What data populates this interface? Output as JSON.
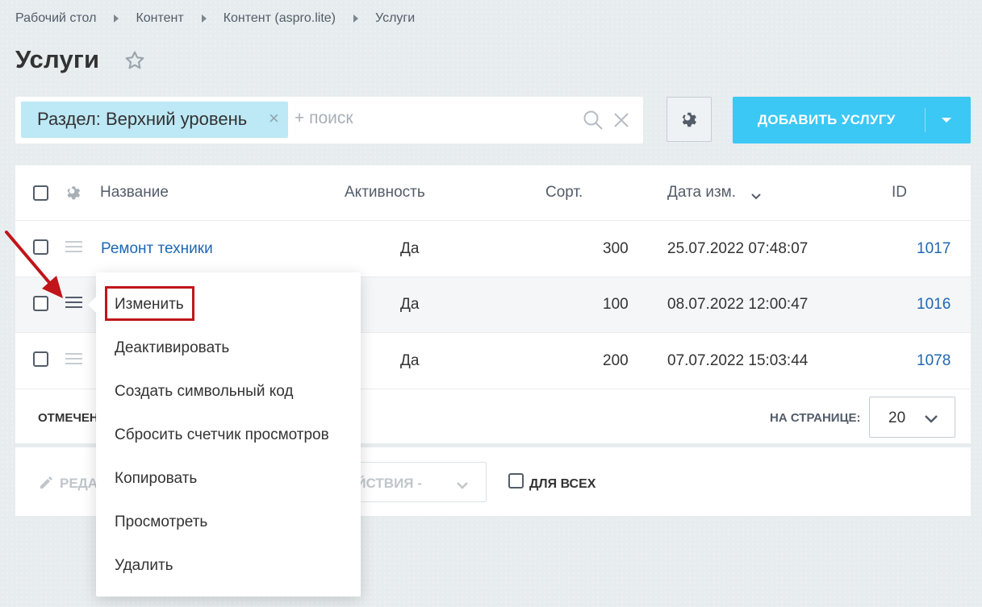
{
  "breadcrumbs": [
    "Рабочий стол",
    "Контент",
    "Контент (aspro.lite)",
    "Услуги"
  ],
  "page": {
    "title": "Услуги"
  },
  "filter": {
    "chip_label": "Раздел: Верхний уровень",
    "search_placeholder": "+ поиск"
  },
  "toolbar": {
    "add_label": "ДОБАВИТЬ УСЛУГУ"
  },
  "grid": {
    "columns": [
      "Название",
      "Активность",
      "Сорт.",
      "Дата изм.",
      "ID"
    ],
    "rows": [
      {
        "name": "Ремонт техники",
        "active": "Да",
        "sort": "300",
        "date": "25.07.2022 07:48:07",
        "id": "1017"
      },
      {
        "name": "",
        "active": "Да",
        "sort": "100",
        "date": "08.07.2022 12:00:47",
        "id": "1016"
      },
      {
        "name": "",
        "active": "Да",
        "sort": "200",
        "date": "07.07.2022 15:03:44",
        "id": "1078"
      }
    ],
    "marked_label": "ОТМЕЧЕН",
    "per_page_label": "НА СТРАНИЦЕ:",
    "per_page_value": "20"
  },
  "actions": {
    "edit_label": "РЕДА",
    "select_label": "ЕЙСТВИЯ -",
    "all_label": "ДЛЯ ВСЕХ"
  },
  "context_menu": {
    "items": [
      "Изменить",
      "Деактивировать",
      "Создать символьный код",
      "Сбросить счетчик просмотров",
      "Копировать",
      "Просмотреть",
      "Удалить"
    ],
    "highlight_color": "#c0151a"
  },
  "colors": {
    "accent": "#3bc8f5",
    "link": "#2067b0",
    "chip": "#bde8f5"
  }
}
